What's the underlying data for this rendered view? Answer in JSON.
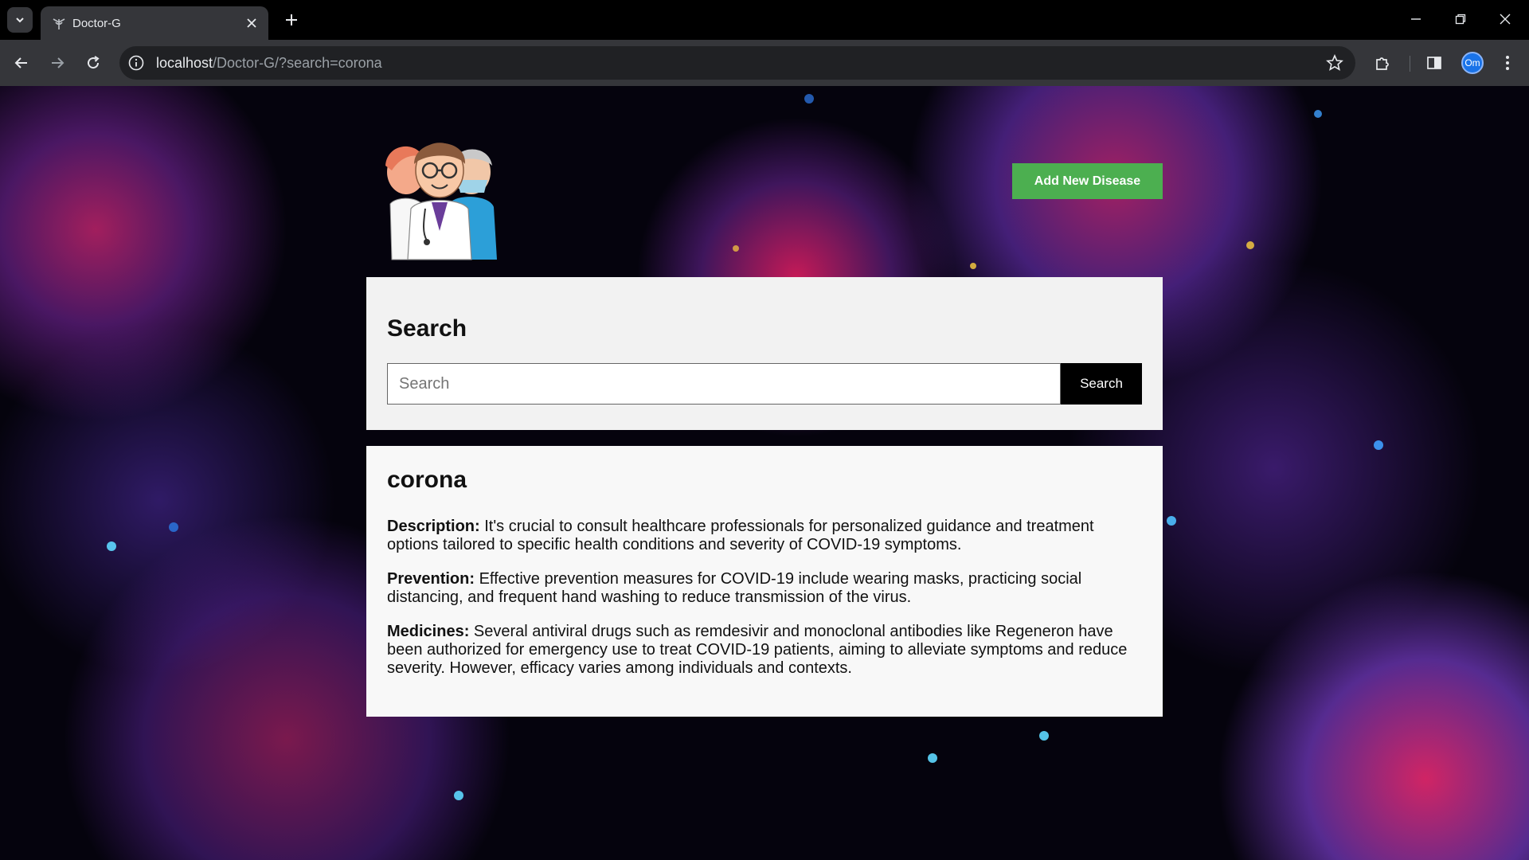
{
  "browser": {
    "tab_title": "Doctor-G",
    "url_host": "localhost",
    "url_path": "/Doctor-G/?search=corona",
    "profile_initials": "Om"
  },
  "header": {
    "logo_icon": "doctors-illustration-icon",
    "add_button_label": "Add New Disease"
  },
  "search": {
    "title": "Search",
    "placeholder": "Search",
    "value": "",
    "button_label": "Search"
  },
  "result": {
    "title": "corona",
    "description_label": "Description:",
    "description_text": " It's crucial to consult healthcare professionals for personalized guidance and treatment options tailored to specific health conditions and severity of COVID-19 symptoms.",
    "prevention_label": "Prevention:",
    "prevention_text": " Effective prevention measures for COVID-19 include wearing masks, practicing social distancing, and frequent hand washing to reduce transmission of the virus.",
    "medicines_label": "Medicines:",
    "medicines_text": " Several antiviral drugs such as remdesivir and monoclonal antibodies like Regeneron have been authorized for emergency use to treat COVID-19 patients, aiming to alleviate symptoms and reduce severity. However, efficacy varies among individuals and contexts."
  },
  "colors": {
    "add_button": "#4caf50",
    "search_button": "#000000",
    "card_background": "#f2f2f2"
  }
}
